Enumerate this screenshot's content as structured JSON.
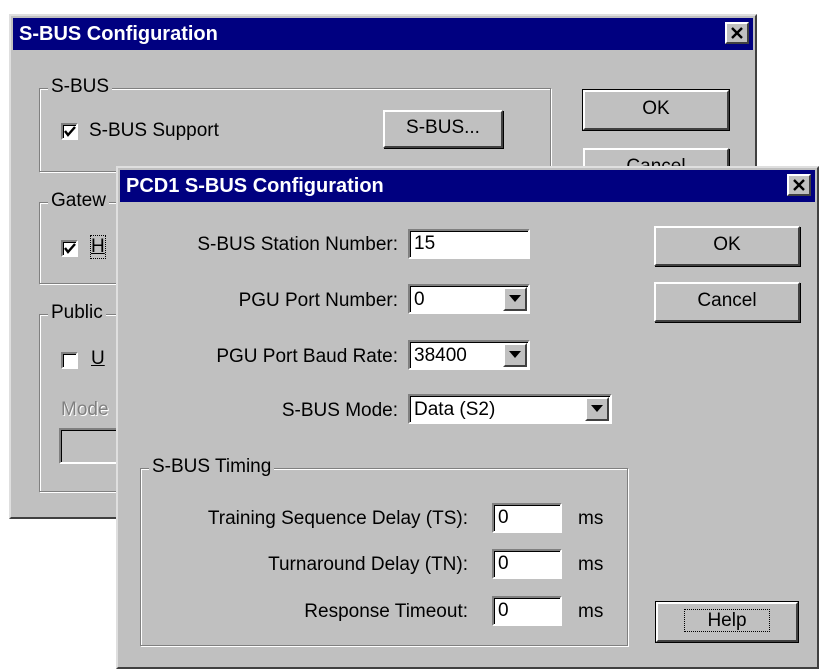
{
  "back_dialog": {
    "title": "S-BUS Configuration",
    "sbus_group": {
      "label": "S-BUS",
      "checkbox_label": "S-BUS Support",
      "checked": true,
      "button_label": "S-BUS..."
    },
    "gateway_group": {
      "label": "Gatew",
      "checkbox_label": "H",
      "checked": true
    },
    "public_group": {
      "label": "Public",
      "checkbox_label": "U",
      "checked": false,
      "mode_label": "Mode"
    },
    "ok_label": "OK",
    "cancel_label": "Cancel"
  },
  "front_dialog": {
    "title": "PCD1 S-BUS Configuration",
    "station_number": {
      "label": "S-BUS Station Number:",
      "value": "15"
    },
    "pgu_port": {
      "label": "PGU Port Number:",
      "value": "0"
    },
    "pgu_baud": {
      "label": "PGU Port Baud Rate:",
      "value": "38400"
    },
    "sbus_mode": {
      "label": "S-BUS Mode:",
      "value": "Data (S2)"
    },
    "timing": {
      "group_label": "S-BUS Timing",
      "ts": {
        "label": "Training Sequence Delay (TS):",
        "value": "0",
        "unit": "ms"
      },
      "tn": {
        "label": "Turnaround Delay (TN):",
        "value": "0",
        "unit": "ms"
      },
      "timeout": {
        "label": "Response Timeout:",
        "value": "0",
        "unit": "ms"
      }
    },
    "ok_label": "OK",
    "cancel_label": "Cancel",
    "help_label": "Help"
  },
  "icons": {
    "close": "close-icon",
    "dropdown": "chevron-down-icon",
    "check": "check-icon"
  }
}
